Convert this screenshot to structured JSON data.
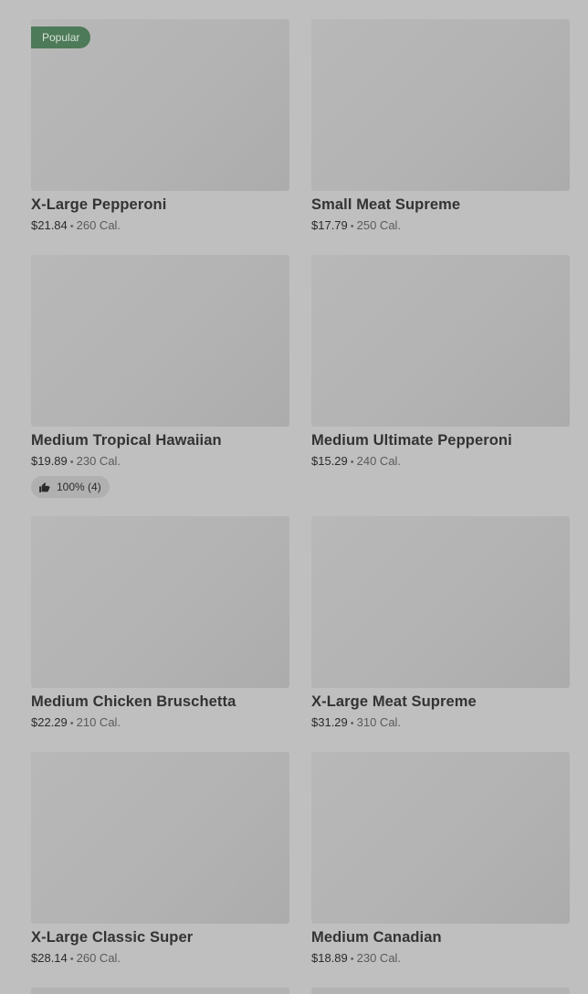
{
  "items": [
    {
      "name": "X-Large Pepperoni",
      "price": "$21.84",
      "cal": "260 Cal.",
      "badge": "Popular"
    },
    {
      "name": "Small Meat Supreme",
      "price": "$17.79",
      "cal": "250 Cal."
    },
    {
      "name": "Medium Tropical Hawaiian",
      "price": "$19.89",
      "cal": "230 Cal.",
      "rating": "100% (4)"
    },
    {
      "name": "Medium Ultimate Pepperoni",
      "price": "$15.29",
      "cal": "240 Cal."
    },
    {
      "name": "Medium Chicken Bruschetta",
      "price": "$22.29",
      "cal": "210 Cal."
    },
    {
      "name": "X-Large Meat Supreme",
      "price": "$31.29",
      "cal": "310 Cal."
    },
    {
      "name": "X-Large Classic Super",
      "price": "$28.14",
      "cal": "260 Cal."
    },
    {
      "name": "Medium Canadian",
      "price": "$18.89",
      "cal": "230 Cal."
    }
  ],
  "separator": "•",
  "colors": {
    "background": "#bfbfbf",
    "image_placeholder": "#b3b3b3",
    "badge_bg": "#4d7a58",
    "rating_bg": "#b0b0b0"
  },
  "icons": {
    "rating": "thumbs-up-icon"
  }
}
